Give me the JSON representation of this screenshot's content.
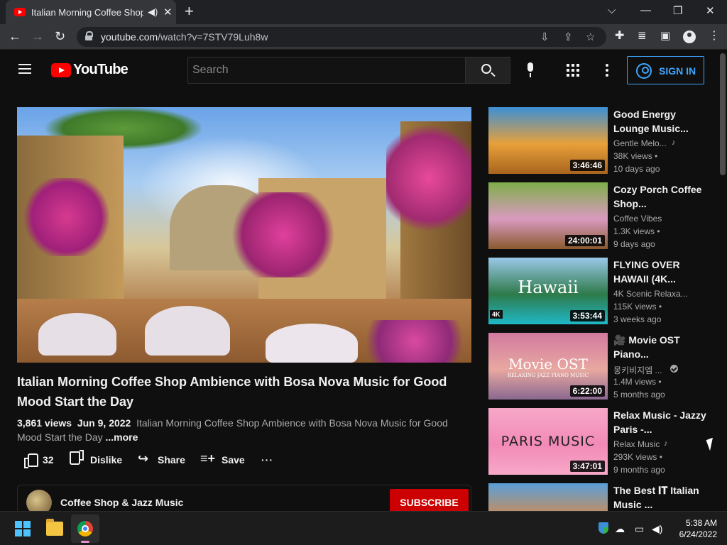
{
  "browser": {
    "tab_title": "Italian Morning Coffee Shop",
    "url_host": "youtube.com",
    "url_path": "/watch?v=7STV79Luh8w",
    "icons": [
      "audio-icon",
      "close-icon",
      "new-tab-icon",
      "back-icon",
      "forward-icon",
      "reload-icon",
      "install-icon",
      "share-icon",
      "bookmark-star-icon",
      "extensions-icon",
      "media-icon",
      "sidepanel-icon",
      "profile-icon",
      "menu-icon"
    ]
  },
  "youtube": {
    "logo_text": "YouTube",
    "search_placeholder": "Search",
    "sign_in": "SIGN IN"
  },
  "video": {
    "title": "Italian Morning Coffee Shop Ambience with Bosa Nova Music for Good Mood Start the Day",
    "views": "3,861 views",
    "date": "Jun 9, 2022",
    "description": "Italian Morning Coffee Shop Ambience with Bosa Nova Music for Good Mood Start the Day",
    "more": "...more",
    "likes": "32",
    "dislike": "Dislike",
    "share": "Share",
    "save": "Save",
    "more_actions": "···",
    "channel": "Coffee Shop & Jazz Music",
    "subscribe": "SUBSCRIBE"
  },
  "recommendations": [
    {
      "title": "Good Energy Lounge Music...",
      "channel": "Gentle Melo...",
      "badge": "music-note-icon",
      "views": "38K views",
      "age": "10 days ago",
      "duration": "3:46:46",
      "thumb_colors": [
        "#3c8fd6",
        "#e8a03a",
        "#a8641e"
      ]
    },
    {
      "title": "Cozy Porch Coffee Shop...",
      "channel": "Coffee Vibes",
      "badge": "",
      "views": "1.3K views",
      "age": "9 days ago",
      "duration": "24:00:01",
      "thumb_colors": [
        "#7fae4a",
        "#d99ac0",
        "#8a5a2e"
      ]
    },
    {
      "title": "FLYING OVER HAWAII (4K...",
      "channel": "4K Scenic Relaxa...",
      "badge": "",
      "views": "115K views",
      "age": "3 weeks ago",
      "duration": "3:53:44",
      "thumb_text": "Hawaii",
      "thumb_badge": "4K",
      "thumb_colors": [
        "#9ac8e8",
        "#2e7a4a",
        "#1fb8c8"
      ]
    },
    {
      "title": "🎥 Movie OST Piano...",
      "channel": "몽키비지엠 ...",
      "badge": "verified-icon",
      "views": "1.4M views",
      "age": "5 months ago",
      "duration": "6:22:00",
      "thumb_text": "Movie OST",
      "thumb_subtext": "RELAXING JAZZ PIANO MUSIC",
      "thumb_colors": [
        "#d27aa0",
        "#e8a8a0",
        "#8a6890"
      ]
    },
    {
      "title": "Relax Music - Jazzy Paris -...",
      "channel": "Relax Music",
      "badge": "music-note-icon",
      "views": "293K views",
      "age": "9 months ago",
      "duration": "3:47:01",
      "thumb_text": "PARIS MUSIC",
      "thumb_colors": [
        "#f7a8c8",
        "#f28ab8",
        "#f7a8c8"
      ]
    },
    {
      "title": "The Best 𝐈𝐓 Italian Music ...",
      "channel": "",
      "badge": "",
      "views": "",
      "age": "",
      "duration": "",
      "thumb_colors": [
        "#5aa0d8",
        "#d88a4a",
        "#3a6a9a"
      ]
    }
  ],
  "taskbar": {
    "time": "5:38 AM",
    "date": "6/24/2022"
  }
}
